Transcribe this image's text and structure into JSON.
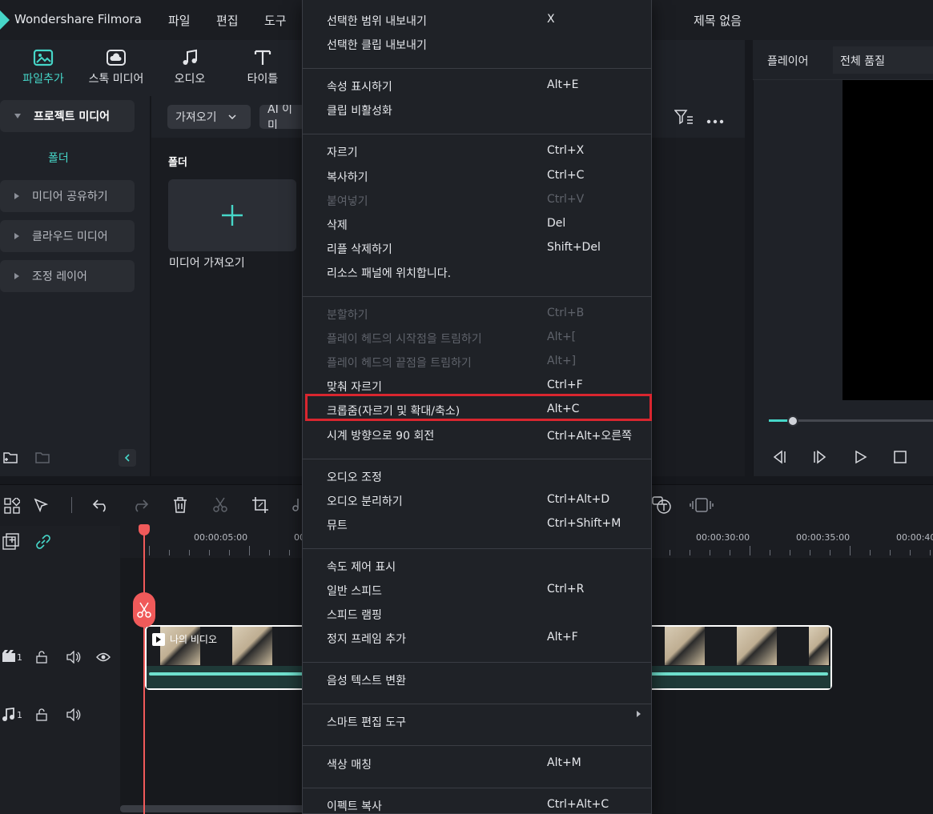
{
  "app": {
    "name": "Wondershare Filmora",
    "document_title": "제목 없음"
  },
  "menubar": [
    "파일",
    "편집",
    "도구"
  ],
  "toolbar": {
    "tools": [
      {
        "label": "파일추가",
        "icon": "media-import-icon"
      },
      {
        "label": "스톡 미디어",
        "icon": "cloud-icon"
      },
      {
        "label": "오디오",
        "icon": "music-note-icon"
      },
      {
        "label": "타이틀",
        "icon": "text-icon"
      }
    ]
  },
  "sidebar": {
    "project_media": "프로젝트 미디어",
    "folder": "폴더",
    "items": [
      "미디어 공유하기",
      "클라우드 미디어",
      "조정 레이어"
    ]
  },
  "media": {
    "import_dropdown": "가져오기",
    "ai_dropdown": "AI 이미",
    "folder_heading": "폴더",
    "import_tile_label": "미디어 가져오기"
  },
  "player": {
    "tab": "플레이어",
    "quality": "전체 품질",
    "progress": 0.03
  },
  "timeline": {
    "timecodes": [
      "00:00:05:00",
      "00:00:30:00",
      "00:00:35:00",
      "00:00:40"
    ],
    "timecode_partial": "00",
    "clip_name": "나의 비디오",
    "tracks": [
      {
        "index": "1",
        "type": "video"
      },
      {
        "index": "1",
        "type": "audio"
      }
    ]
  },
  "context_menu": {
    "highlighted": "크롭줌(자르기 및 확대/축소)",
    "groups": [
      [
        {
          "label": "선택한 범위 내보내기",
          "shortcut": "X"
        },
        {
          "label": "선택한 클립 내보내기",
          "shortcut": ""
        }
      ],
      [
        {
          "label": "속성 표시하기",
          "shortcut": "Alt+E"
        },
        {
          "label": "클립 비활성화",
          "shortcut": ""
        }
      ],
      [
        {
          "label": "자르기",
          "shortcut": "Ctrl+X"
        },
        {
          "label": "복사하기",
          "shortcut": "Ctrl+C"
        },
        {
          "label": "붙여넣기",
          "shortcut": "Ctrl+V",
          "disabled": true
        },
        {
          "label": "삭제",
          "shortcut": "Del"
        },
        {
          "label": "리플 삭제하기",
          "shortcut": "Shift+Del"
        },
        {
          "label": "리소스 패널에 위치합니다.",
          "shortcut": ""
        }
      ],
      [
        {
          "label": "분할하기",
          "shortcut": "Ctrl+B",
          "disabled": true
        },
        {
          "label": "플레이 헤드의 시작점을 트림하기",
          "shortcut": "Alt+[",
          "disabled": true
        },
        {
          "label": "플레이 헤드의 끝점을 트림하기",
          "shortcut": "Alt+]",
          "disabled": true
        },
        {
          "label": "맞춰 자르기",
          "shortcut": "Ctrl+F"
        },
        {
          "label": "크롭줌(자르기 및 확대/축소)",
          "shortcut": "Alt+C"
        },
        {
          "label": "시계 방향으로 90 회전",
          "shortcut": "Ctrl+Alt+오른쪽"
        }
      ],
      [
        {
          "label": "오디오 조정",
          "shortcut": ""
        },
        {
          "label": "오디오 분리하기",
          "shortcut": "Ctrl+Alt+D"
        },
        {
          "label": "뮤트",
          "shortcut": "Ctrl+Shift+M"
        }
      ],
      [
        {
          "label": "속도 제어 표시",
          "shortcut": ""
        },
        {
          "label": "일반 스피드",
          "shortcut": "Ctrl+R"
        },
        {
          "label": "스피드 램핑",
          "shortcut": ""
        },
        {
          "label": "정지 프레임 추가",
          "shortcut": "Alt+F"
        }
      ],
      [
        {
          "label": "음성 텍스트 변환",
          "shortcut": ""
        }
      ],
      [
        {
          "label": "스마트 편집 도구",
          "shortcut": "",
          "submenu": true
        }
      ],
      [
        {
          "label": "색상 매칭",
          "shortcut": "Alt+M"
        }
      ],
      [
        {
          "label": "이펙트 복사",
          "shortcut": "Ctrl+Alt+C"
        }
      ]
    ]
  },
  "colors": {
    "accent": "#46d6c8",
    "highlight_border": "#d9262f",
    "playhead": "#f05a5a"
  }
}
